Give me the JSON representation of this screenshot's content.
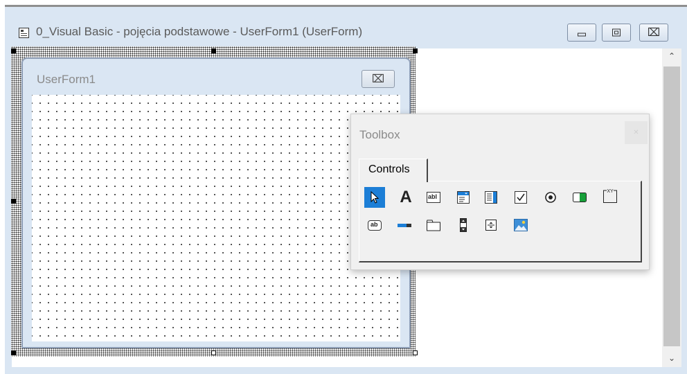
{
  "window": {
    "title": "0_Visual Basic - pojęcia podstawowe - UserForm1 (UserForm)",
    "buttons": [
      "minimize",
      "restore",
      "close"
    ]
  },
  "userform": {
    "title": "UserForm1"
  },
  "toolbox": {
    "title": "Toolbox",
    "tab_label": "Controls",
    "selected_tool": "select-objects",
    "row1": [
      "select-objects-icon",
      "label-icon",
      "textbox-icon",
      "combobox-icon",
      "listbox-icon",
      "checkbox-icon",
      "optionbutton-icon",
      "togglebutton-icon",
      "frame-icon"
    ],
    "row2": [
      "commandbutton-icon",
      "tabstrip-icon",
      "multipage-icon",
      "scrollbar-icon",
      "spinbutton-icon",
      "image-icon"
    ],
    "label_glyph": "A",
    "textbox_glyph": "abl",
    "commandbutton_glyph": "ab",
    "frame_glyph": "XY"
  },
  "colors": {
    "window_frame": "#dae6f3",
    "selection": "#1c7ed6",
    "toggle_green": "#18a03a"
  }
}
